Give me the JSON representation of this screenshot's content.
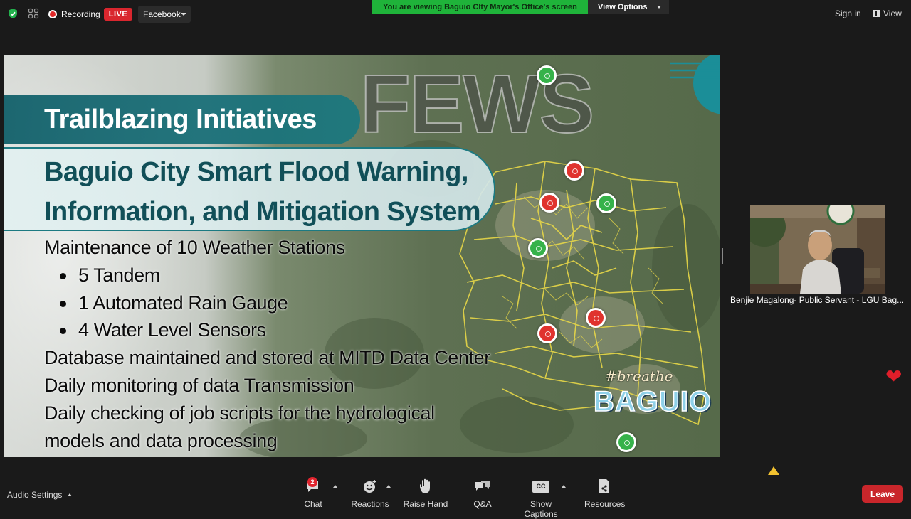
{
  "topbar": {
    "recording_label": "Recording",
    "live_label": "LIVE",
    "stream_target": "Facebook",
    "viewing_banner": "You are viewing Baguio CIty Mayor's Office's screen",
    "view_options_label": "View Options",
    "sign_in_label": "Sign in",
    "view_label": "View",
    "banner_color": "#1fb33a",
    "live_color": "#d9262e"
  },
  "slide": {
    "watermark": "FEWS",
    "section_title": "Trailblazing Initiatives",
    "heading_line1": "Baguio City Smart Flood Warning,",
    "heading_line2": "Information, and Mitigation System",
    "line1": "Maintenance of 10 Weather Stations",
    "bullets": [
      "5 Tandem",
      "1 Automated Rain  Gauge",
      "4 Water Level Sensors"
    ],
    "line2": "Database maintained and stored at MITD Data Center",
    "line3": "Daily monitoring of data Transmission",
    "line4a": "Daily checking of job scripts for the hydrological",
    "line4b": "models and data processing",
    "brand_script": "#breathe",
    "brand_main": "BAGUIO",
    "title_color": "#12606a",
    "heading_color": "#114f58"
  },
  "participant": {
    "name": "Benjie Magalong- Public Servant - LGU Bag..."
  },
  "reactions": {
    "heart_icon": "heart-icon"
  },
  "toolbar": {
    "audio_settings_label": "Audio Settings",
    "chat_label": "Chat",
    "chat_badge": "2",
    "reactions_label": "Reactions",
    "raise_hand_label": "Raise Hand",
    "qa_label": "Q&A",
    "captions_label": "Show Captions",
    "cc_text": "CC",
    "resources_label": "Resources",
    "leave_label": "Leave",
    "leave_color": "#c9262b"
  }
}
